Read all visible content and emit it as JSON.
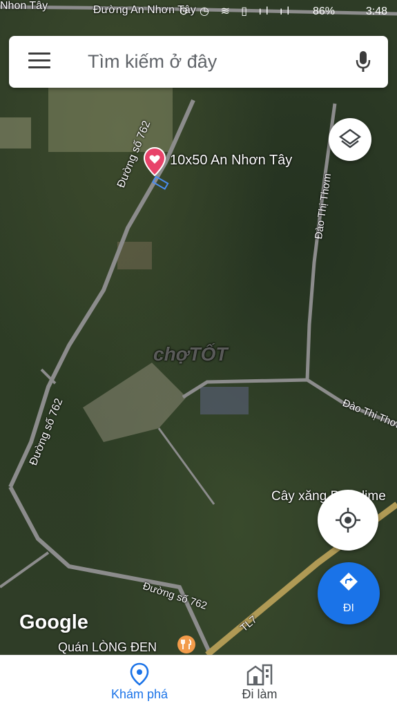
{
  "status_bar": {
    "time": "3:48",
    "battery": "86%"
  },
  "search": {
    "placeholder": "Tìm kiếm ở đây"
  },
  "map": {
    "roads": [
      "Đường An Nhơn Tây",
      "Đường số 762",
      "Đường số 762",
      "Đào Thị Thơm",
      "Đào Thị Thơm",
      "Đường số 762",
      "TL7",
      "Nhon Tây"
    ],
    "pin_label": "10x50 An Nhơn Tây",
    "poi_gas": "Cây xăng Petrolime",
    "poi_restaurant": "Quán LÒNG ĐEN",
    "attribution": "Google",
    "watermark": "chợTỐT"
  },
  "controls": {
    "directions_label": "ĐI"
  },
  "bottom_nav": {
    "explore": "Khám phá",
    "commute": "Đi làm"
  },
  "colors": {
    "accent": "#1a73e8",
    "pin": "#e8436a"
  }
}
